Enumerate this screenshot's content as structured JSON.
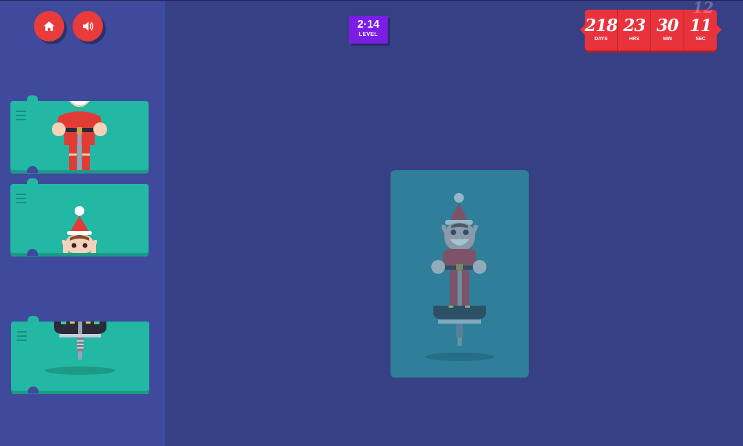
{
  "controls": {
    "home_icon": "home-icon",
    "sound_icon": "speaker-icon"
  },
  "level": {
    "number": "2·14",
    "label": "LEVEL",
    "color": "#7a1ee6"
  },
  "countdown": {
    "days": "218",
    "days_label": "DAYS",
    "hours": "23",
    "hours_label": "HRS",
    "minutes": "30",
    "minutes_label": "MIN",
    "seconds": "11",
    "seconds_label": "SEC",
    "next_seconds": "12",
    "color": "#e8333d"
  },
  "blocks": [
    {
      "part": "elf-body"
    },
    {
      "part": "elf-head"
    },
    {
      "part": "pogo-stick"
    }
  ],
  "colors": {
    "background": "#373f85",
    "sidebar": "#3f4a9c",
    "block": "#22b8a4",
    "preview": "#2f7f9a"
  }
}
